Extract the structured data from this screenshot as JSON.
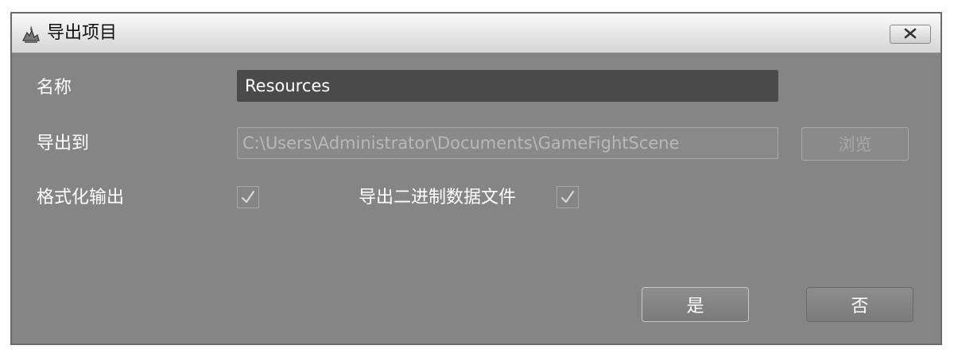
{
  "window": {
    "title": "导出项目",
    "close_label": "X"
  },
  "form": {
    "name_label": "名称",
    "name_value": "Resources",
    "export_to_label": "导出到",
    "export_path": "C:\\Users\\Administrator\\Documents\\GameFightScene",
    "browse_label": "浏览",
    "format_output_label": "格式化输出",
    "format_output_checked": true,
    "export_binary_label": "导出二进制数据文件",
    "export_binary_checked": true
  },
  "buttons": {
    "yes_label": "是",
    "no_label": "否"
  },
  "icons": {
    "app": "app-icon",
    "close": "close-icon",
    "check": "check-icon"
  }
}
